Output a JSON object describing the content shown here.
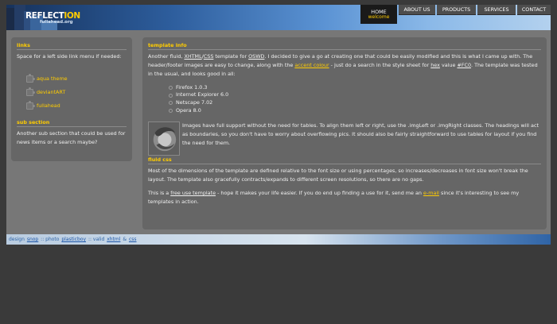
{
  "header": {
    "logo_main_a": "REFLECT",
    "logo_main_b": "ION",
    "logo_sub": "fullahead.org",
    "home": {
      "label": "HOME",
      "sublabel": "welcome"
    },
    "nav": [
      "ABOUT US",
      "PRODUCTS",
      "SERVICES",
      "CONTACT"
    ]
  },
  "sidebar": {
    "links_title": "links",
    "links_text": "Space for a left side link menu if needed:",
    "links": [
      "aqua theme",
      "deviantART",
      "fullahead"
    ],
    "sub_title": "sub section",
    "sub_text": "Another sub section that could be used for news items or a search maybe?"
  },
  "content": {
    "title": "template info",
    "p1": {
      "a": "Another fluid,",
      "xhtml": "XHTML",
      "slash": "/",
      "css": "CSS",
      "b": "template for",
      "oswd": "OSWD",
      "c": ". I decided to give a go at creating one that could be easily modified and this is what I came up with. The header/footer images are easy to change, along with the",
      "accent": "accent colour",
      "d": "- just do a search in the style sheet for",
      "hex": "hex",
      "e": "value",
      "hexval": "#FC0",
      "f": ". The template was tested in the usual, and looks good in all:"
    },
    "browsers": [
      "Firefox 1.0.3",
      "Internet Explorer 6.0",
      "Netscape 7.02",
      "Opera 8.0"
    ],
    "p2": "Images have full support without the need for tables. To align them left or right, use the .imgLeft or .imgRight classes. The headings will act as boundaries, so you don't have to worry about overflowing pics. It should also be fairly straightforward to use tables for layout if you find the need for them.",
    "fluid_title": "fluid css",
    "p3": "Most of the dimensions of the template are defined relative to the font size or using percentages, so increases/decreases in font size won't break the layout. The template also gracefully contracts/expands to different screen resolutions, so there are no gaps.",
    "p4": {
      "a": "This is a",
      "free": "free use template",
      "b": "- hope it makes your life easier. If you do end up finding a use for it, send me an",
      "email": "e-mail",
      "c": "since it's interesting to see my templates in action."
    }
  },
  "footer": {
    "design": "design",
    "snop": "snop",
    "sep1": "::",
    "photo": "photo",
    "plasticboy": "plasticboy",
    "sep2": "::",
    "valid": "valid",
    "xhtml": "xhtml",
    "amp": "&",
    "css": "css"
  },
  "colors": {
    "accent": "#ffcc00",
    "background": "#3a3a3a",
    "panel": "#666666",
    "frame": "#777777"
  }
}
